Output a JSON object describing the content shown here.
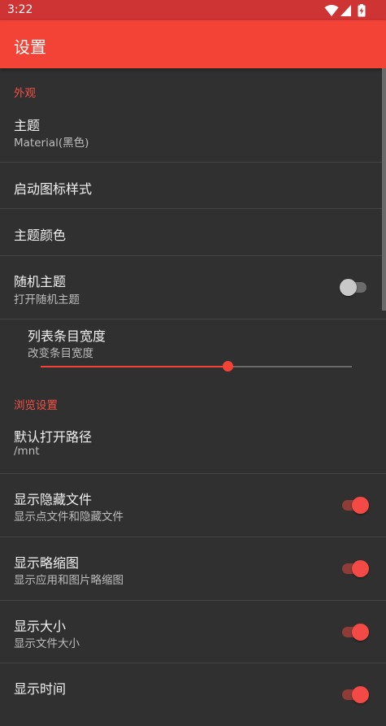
{
  "status_bar": {
    "time": "3:22",
    "icons": [
      "wifi-icon",
      "cell-signal-icon",
      "battery-charging-icon"
    ]
  },
  "app_bar": {
    "title": "设置"
  },
  "sections": [
    {
      "header": "外观",
      "items": [
        {
          "title": "主题",
          "summary": "Material(黑色)"
        },
        {
          "title": "启动图标样式"
        },
        {
          "title": "主题颜色"
        },
        {
          "title": "随机主题",
          "summary": "打开随机主题",
          "switch": false
        },
        {
          "title": "列表条目宽度",
          "summary": "改变条目宽度",
          "slider_value": 0.6
        }
      ]
    },
    {
      "header": "浏览设置",
      "items": [
        {
          "title": "默认打开路径",
          "summary": "/mnt"
        },
        {
          "title": "显示隐藏文件",
          "summary": "显示点文件和隐藏文件",
          "switch": true
        },
        {
          "title": "显示略缩图",
          "summary": "显示应用和图片略缩图",
          "switch": true
        },
        {
          "title": "显示大小",
          "summary": "显示文件大小",
          "switch": true
        },
        {
          "title": "显示时间",
          "switch": true
        }
      ]
    }
  ],
  "colors": {
    "status_bar": "#cf3434",
    "app_bar": "#f34336",
    "accent": "#f34336",
    "background": "#303030"
  }
}
